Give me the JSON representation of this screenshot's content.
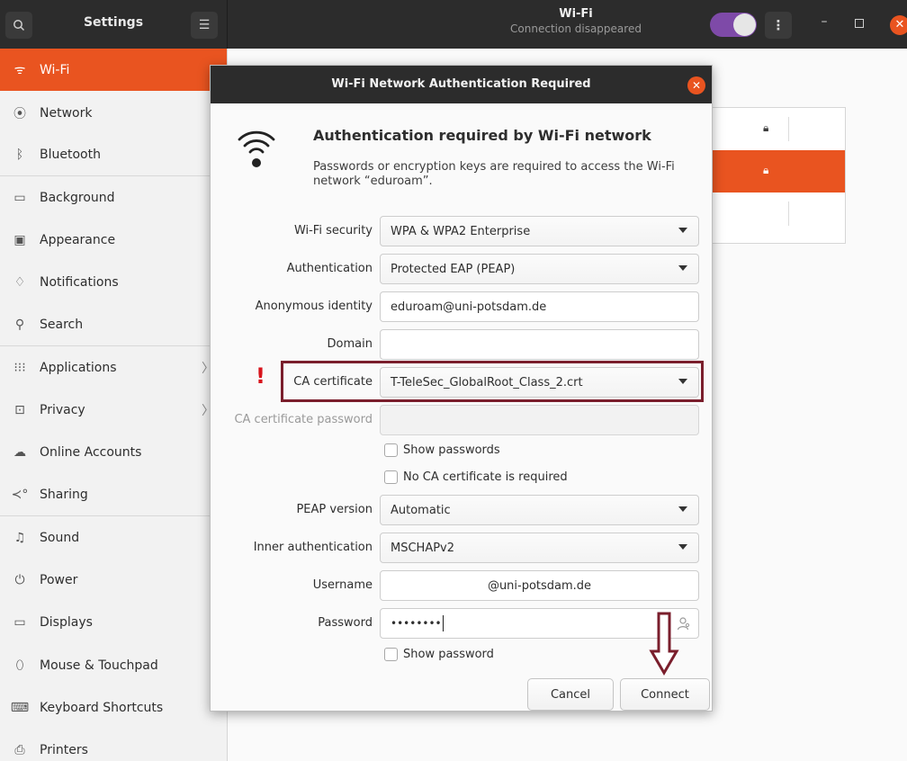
{
  "colors": {
    "accent": "#e95420",
    "annotation": "#7a1e2c",
    "warning": "#d8141c",
    "toggle": "#7e4aa8"
  },
  "header": {
    "app_title": "Settings",
    "page_title": "Wi-Fi",
    "page_subtitle": "Connection disappeared",
    "wifi_enabled": true
  },
  "sidebar": {
    "items": [
      {
        "label": "Wi-Fi",
        "icon": "wifi-icon",
        "active": true
      },
      {
        "label": "Network",
        "icon": "network-icon"
      },
      {
        "label": "Bluetooth",
        "icon": "bluetooth-icon"
      },
      {
        "label": "Background",
        "icon": "background-icon"
      },
      {
        "label": "Appearance",
        "icon": "appearance-icon"
      },
      {
        "label": "Notifications",
        "icon": "bell-icon"
      },
      {
        "label": "Search",
        "icon": "search-icon"
      },
      {
        "label": "Applications",
        "icon": "grid-icon",
        "has_submenu": true
      },
      {
        "label": "Privacy",
        "icon": "lock-icon",
        "has_submenu": true
      },
      {
        "label": "Online Accounts",
        "icon": "cloud-icon"
      },
      {
        "label": "Sharing",
        "icon": "share-icon"
      },
      {
        "label": "Sound",
        "icon": "music-note-icon"
      },
      {
        "label": "Power",
        "icon": "power-icon"
      },
      {
        "label": "Displays",
        "icon": "display-icon"
      },
      {
        "label": "Mouse & Touchpad",
        "icon": "mouse-icon"
      },
      {
        "label": "Keyboard Shortcuts",
        "icon": "keyboard-icon"
      },
      {
        "label": "Printers",
        "icon": "printer-icon"
      }
    ]
  },
  "dialog": {
    "title": "Wi-Fi Network Authentication Required",
    "heading": "Authentication required by Wi-Fi network",
    "description": "Passwords or encryption keys are required to access the Wi-Fi network “eduroam”.",
    "fields": {
      "wifi_security": {
        "label": "Wi-Fi security",
        "value": "WPA & WPA2 Enterprise"
      },
      "authentication": {
        "label": "Authentication",
        "value": "Protected EAP (PEAP)"
      },
      "anonymous_identity": {
        "label": "Anonymous identity",
        "value": "eduroam@uni-potsdam.de"
      },
      "domain": {
        "label": "Domain",
        "value": ""
      },
      "ca_certificate": {
        "label": "CA certificate",
        "value": "T-TeleSec_GlobalRoot_Class_2.crt"
      },
      "ca_certificate_password": {
        "label": "CA certificate password",
        "value": ""
      },
      "show_passwords": {
        "label": "Show passwords",
        "checked": false
      },
      "no_ca_required": {
        "label": "No CA certificate is required",
        "checked": false
      },
      "peap_version": {
        "label": "PEAP version",
        "value": "Automatic"
      },
      "inner_authentication": {
        "label": "Inner authentication",
        "value": "MSCHAPv2"
      },
      "username": {
        "label": "Username",
        "value": "@uni-potsdam.de"
      },
      "password": {
        "label": "Password",
        "value": "••••••••"
      },
      "show_password": {
        "label": "Show password",
        "checked": false
      }
    },
    "buttons": {
      "cancel": "Cancel",
      "connect": "Connect"
    },
    "warning_mark": "!"
  }
}
